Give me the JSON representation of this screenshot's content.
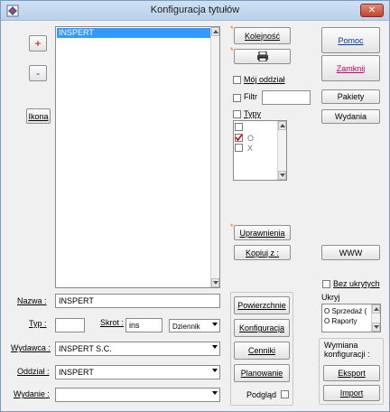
{
  "window": {
    "title": "Konfiguracja tytułów",
    "close_label": "✕"
  },
  "left_buttons": {
    "plus": "+",
    "minus": "-",
    "ikona": "Ikona"
  },
  "titles_list": {
    "items": [
      "INSPERT"
    ],
    "selected": 0
  },
  "top_buttons": {
    "kolejnosc": "Kolejność",
    "print_icon": "printer-icon",
    "uprawnienia": "Uprawnienia",
    "kopiuj": "Kopiuj z :"
  },
  "filters": {
    "moj_oddzial": "Mój oddział",
    "filtr": "Filtr",
    "typy": "Typy",
    "filtr_value": ""
  },
  "types_list": {
    "items": [
      {
        "label": "",
        "checked": false
      },
      {
        "label": "O",
        "checked": true
      },
      {
        "label": "X",
        "checked": false
      }
    ]
  },
  "right_buttons": {
    "pomoc": "Pomoc",
    "zamknij": "Zamknij",
    "pakiety": "Pakiety",
    "wydania": "Wydania",
    "www": "WWW"
  },
  "form": {
    "nazwa_label": "Nazwa :",
    "nazwa_value": "INSPERT",
    "typ_label": "Typ :",
    "typ_value": "",
    "skrot_label": "Skrot :",
    "skrot_value": "ins",
    "periodicity_value": "Dziennik",
    "wydawca_label": "Wydawca :",
    "wydawca_value": "INSPERT S.C.",
    "oddzial_label": "Oddział :",
    "oddzial_value": "INSPERT",
    "wydanie_label": "Wydanie :",
    "wydanie_value": ""
  },
  "middle_buttons": {
    "powierzchnie": "Powierzchnie",
    "konfiguracja": "Konfiguracja",
    "cenniki": "Cenniki",
    "planowanie": "Planowanie",
    "podglad": "Podgląd"
  },
  "hidden": {
    "bez_ukrytych": "Bez ukrytych",
    "ukryj": "Ukryj",
    "items": [
      "O   Sprzedaż (",
      "O   Raporty"
    ]
  },
  "exchange": {
    "label_line1": "Wymiana",
    "label_line2": "konfiguracji :",
    "eksport": "Eksport",
    "import": "Import"
  }
}
